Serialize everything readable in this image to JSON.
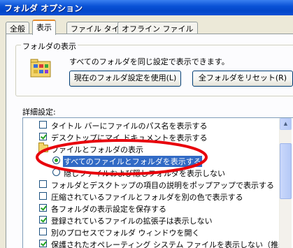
{
  "window": {
    "title": "フォルダ オプション"
  },
  "tabs": [
    {
      "label": "全般",
      "active": false
    },
    {
      "label": "表示",
      "active": true
    },
    {
      "label": "ファイル タイプ",
      "active": false
    },
    {
      "label": "オフライン ファイル",
      "active": false
    }
  ],
  "folder_view": {
    "group_title": "フォルダの表示",
    "description": "すべてのフォルダを同じ設定で表示できます。",
    "apply_button": "現在のフォルダ設定を使用(L)",
    "reset_button": "全フォルダをリセット(R)",
    "icon": "folder-view-icon"
  },
  "advanced": {
    "label": "詳細設定:",
    "items": [
      {
        "type": "checkbox",
        "checked": false,
        "label": "タイトル バーにファイルのパス名を表示する"
      },
      {
        "type": "checkbox",
        "checked": true,
        "label": "デスクトップにマイ ドキュメントを表示する"
      },
      {
        "type": "folder",
        "label": "ファイルとフォルダの表示"
      },
      {
        "type": "radio",
        "checked": true,
        "label": "すべてのファイルとフォルダを表示する"
      },
      {
        "type": "radio",
        "checked": false,
        "label": "隠しファイルおよび隠しフォルダを表示しない"
      },
      {
        "type": "checkbox",
        "checked": false,
        "label": "フォルダとデスクトップの項目の説明をポップアップで表示する"
      },
      {
        "type": "checkbox",
        "checked": false,
        "label": "圧縮されているファイルとフォルダを別の色で表示する"
      },
      {
        "type": "checkbox",
        "checked": true,
        "label": "各フォルダの表示設定を保存する"
      },
      {
        "type": "checkbox",
        "checked": true,
        "label": "登録されているファイルの拡張子は表示しない"
      },
      {
        "type": "checkbox",
        "checked": false,
        "label": "別のプロセスでフォルダ ウィンドウを開く"
      },
      {
        "type": "checkbox",
        "checked": true,
        "label": "保護されたオペレーティング システム ファイルを表示しない（推奨）"
      }
    ]
  },
  "colors": {
    "titlebar": "#0a52d6",
    "highlight_ellipse": "#e8000b",
    "selection": "#316ac5",
    "check": "#21a121"
  }
}
